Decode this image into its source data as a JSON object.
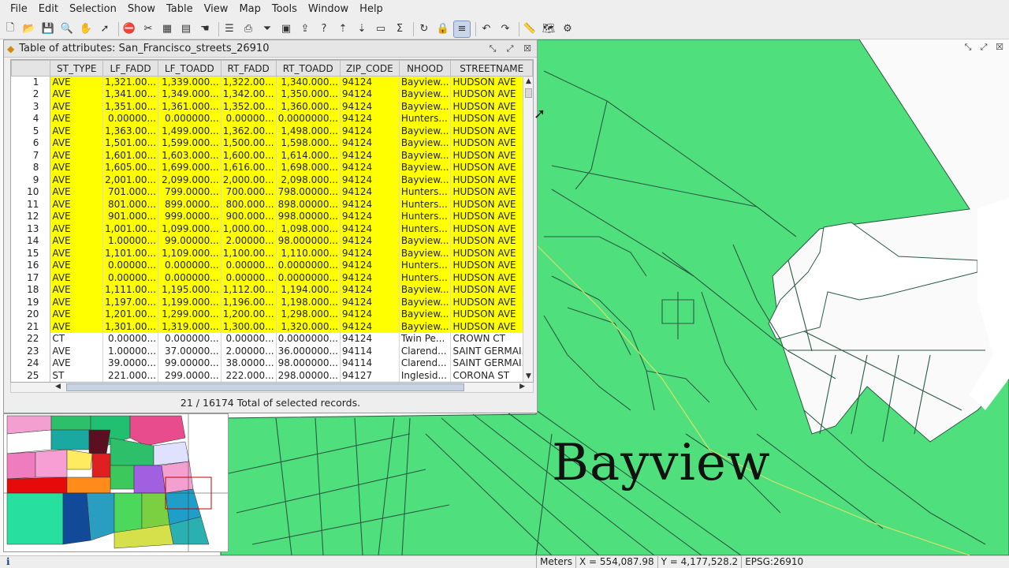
{
  "menu": [
    "File",
    "Edit",
    "Selection",
    "Show",
    "Table",
    "View",
    "Map",
    "Tools",
    "Window",
    "Help"
  ],
  "toolbar_icons": [
    "new-icon",
    "open-icon",
    "save-icon",
    "zoom-icon",
    "pan-icon",
    "select-icon",
    "stop-icon",
    "tools-icon",
    "table-icon",
    "grid-icon",
    "hand-icon",
    "list-icon",
    "print-icon",
    "filter-icon",
    "layer-icon",
    "export-icon",
    "query-icon",
    "sort-asc-icon",
    "sort-desc-icon",
    "field-icon",
    "sum-icon",
    "refresh-icon",
    "lock-icon",
    "align-icon",
    "undo-icon",
    "redo-icon",
    "ruler-icon",
    "map-icon",
    "gear-icon"
  ],
  "attr_window": {
    "title": "Table of attributes: San_Francisco_streets_26910",
    "columns": [
      "ST_TYPE",
      "LF_FADD",
      "LF_TOADD",
      "RT_FADD",
      "RT_TOADD",
      "ZIP_CODE",
      "NHOOD",
      "STREETNAME"
    ],
    "rows": [
      {
        "n": "1",
        "sel": true,
        "cells": [
          "AVE",
          "1,321.00...",
          "1,339.000...",
          "1,322.00...",
          "1,340.000...",
          "94124",
          "Bayview...",
          "HUDSON AVE"
        ]
      },
      {
        "n": "2",
        "sel": true,
        "cells": [
          "AVE",
          "1,341.00...",
          "1,349.000...",
          "1,342.00...",
          "1,350.000...",
          "94124",
          "Bayview...",
          "HUDSON AVE"
        ]
      },
      {
        "n": "3",
        "sel": true,
        "cells": [
          "AVE",
          "1,351.00...",
          "1,361.000...",
          "1,352.00...",
          "1,360.000...",
          "94124",
          "Bayview...",
          "HUDSON AVE"
        ]
      },
      {
        "n": "4",
        "sel": true,
        "cells": [
          "AVE",
          "0.00000...",
          "0.000000...",
          "0.00000...",
          "0.0000000...",
          "94124",
          "Hunters...",
          "HUDSON AVE"
        ]
      },
      {
        "n": "5",
        "sel": true,
        "cells": [
          "AVE",
          "1,363.00...",
          "1,499.000...",
          "1,362.00...",
          "1,498.000...",
          "94124",
          "Bayview...",
          "HUDSON AVE"
        ]
      },
      {
        "n": "6",
        "sel": true,
        "cells": [
          "AVE",
          "1,501.00...",
          "1,599.000...",
          "1,500.00...",
          "1,598.000...",
          "94124",
          "Bayview...",
          "HUDSON AVE"
        ]
      },
      {
        "n": "7",
        "sel": true,
        "cells": [
          "AVE",
          "1,601.00...",
          "1,603.000...",
          "1,600.00...",
          "1,614.000...",
          "94124",
          "Bayview...",
          "HUDSON AVE"
        ]
      },
      {
        "n": "8",
        "sel": true,
        "cells": [
          "AVE",
          "1,605.00...",
          "1,699.000...",
          "1,616.00...",
          "1,698.000...",
          "94124",
          "Bayview...",
          "HUDSON AVE"
        ]
      },
      {
        "n": "9",
        "sel": true,
        "cells": [
          "AVE",
          "2,001.00...",
          "2,099.000...",
          "2,000.00...",
          "2,098.000...",
          "94124",
          "Bayview...",
          "HUDSON AVE"
        ]
      },
      {
        "n": "10",
        "sel": true,
        "cells": [
          "AVE",
          "701.000...",
          "799.0000...",
          "700.000...",
          "798.00000...",
          "94124",
          "Hunters...",
          "HUDSON AVE"
        ]
      },
      {
        "n": "11",
        "sel": true,
        "cells": [
          "AVE",
          "801.000...",
          "899.0000...",
          "800.000...",
          "898.00000...",
          "94124",
          "Hunters...",
          "HUDSON AVE"
        ]
      },
      {
        "n": "12",
        "sel": true,
        "cells": [
          "AVE",
          "901.000...",
          "999.0000...",
          "900.000...",
          "998.00000...",
          "94124",
          "Hunters...",
          "HUDSON AVE"
        ]
      },
      {
        "n": "13",
        "sel": true,
        "cells": [
          "AVE",
          "1,001.00...",
          "1,099.000...",
          "1,000.00...",
          "1,098.000...",
          "94124",
          "Hunters...",
          "HUDSON AVE"
        ]
      },
      {
        "n": "14",
        "sel": true,
        "cells": [
          "AVE",
          "1.00000...",
          "99.00000...",
          "2.00000...",
          "98.000000...",
          "94124",
          "Bayview...",
          "HUDSON AVE"
        ]
      },
      {
        "n": "15",
        "sel": true,
        "cells": [
          "AVE",
          "1,101.00...",
          "1,109.000...",
          "1,100.00...",
          "1,110.000...",
          "94124",
          "Bayview...",
          "HUDSON AVE"
        ]
      },
      {
        "n": "16",
        "sel": true,
        "cells": [
          "AVE",
          "0.00000...",
          "0.000000...",
          "0.00000...",
          "0.0000000...",
          "94124",
          "Hunters...",
          "HUDSON AVE"
        ]
      },
      {
        "n": "17",
        "sel": true,
        "cells": [
          "AVE",
          "0.00000...",
          "0.000000...",
          "0.00000...",
          "0.0000000...",
          "94124",
          "Hunters...",
          "HUDSON AVE"
        ]
      },
      {
        "n": "18",
        "sel": true,
        "cells": [
          "AVE",
          "1,111.00...",
          "1,195.000...",
          "1,112.00...",
          "1,194.000...",
          "94124",
          "Bayview...",
          "HUDSON AVE"
        ]
      },
      {
        "n": "19",
        "sel": true,
        "cells": [
          "AVE",
          "1,197.00...",
          "1,199.000...",
          "1,196.00...",
          "1,198.000...",
          "94124",
          "Bayview...",
          "HUDSON AVE"
        ]
      },
      {
        "n": "20",
        "sel": true,
        "cells": [
          "AVE",
          "1,201.00...",
          "1,299.000...",
          "1,200.00...",
          "1,298.000...",
          "94124",
          "Bayview...",
          "HUDSON AVE"
        ]
      },
      {
        "n": "21",
        "sel": true,
        "cells": [
          "AVE",
          "1,301.00...",
          "1,319.000...",
          "1,300.00...",
          "1,320.000...",
          "94124",
          "Bayview...",
          "HUDSON AVE"
        ]
      },
      {
        "n": "22",
        "sel": false,
        "cells": [
          "CT",
          "0.00000...",
          "0.000000...",
          "0.00000...",
          "0.0000000...",
          "94124",
          "Twin Pe...",
          "CROWN CT"
        ]
      },
      {
        "n": "23",
        "sel": false,
        "cells": [
          "AVE",
          "1.00000...",
          "37.00000...",
          "2.00000...",
          "36.000000...",
          "94114",
          "Clarend...",
          "SAINT GERMAI..."
        ]
      },
      {
        "n": "24",
        "sel": false,
        "cells": [
          "AVE",
          "39.0000...",
          "99.00000...",
          "38.0000...",
          "98.000000...",
          "94114",
          "Clarend...",
          "SAINT GERMAI..."
        ]
      },
      {
        "n": "25",
        "sel": false,
        "cells": [
          "ST",
          "221.000...",
          "299.0000...",
          "222.000...",
          "298.00000...",
          "94127",
          "Inglesid...",
          "CORONA ST"
        ]
      }
    ],
    "status": "21 / 16174 Total of selected records."
  },
  "map": {
    "label": "Bayview"
  },
  "statusbar": {
    "info": "i",
    "units": "Meters",
    "x": "X = 554,087.98",
    "y": "Y = 4,177,528.2",
    "epsg": "EPSG:26910"
  },
  "colors": {
    "map_fill": "#4fe07d",
    "street_line": "#2a5a40",
    "selection": "#ffff00"
  }
}
